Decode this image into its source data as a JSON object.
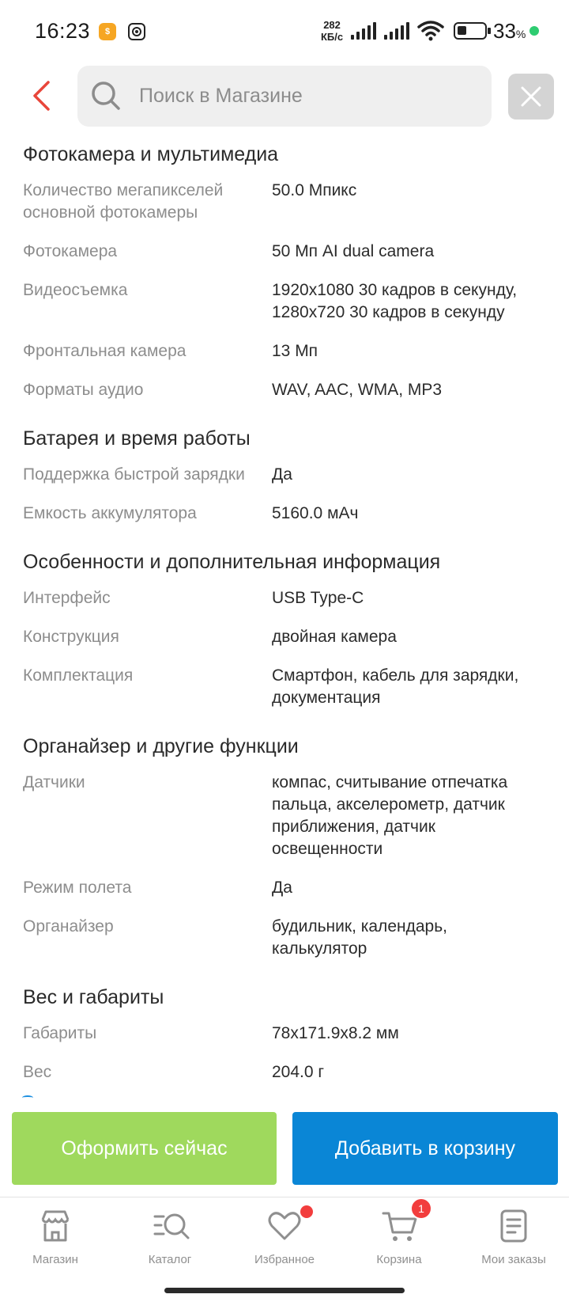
{
  "status_bar": {
    "time": "16:23",
    "net_speed_value": "282",
    "net_speed_unit": "КБ/с",
    "battery_percent": "33",
    "battery_percent_sign": "%",
    "battery_level": 0.33,
    "icons": [
      "notification-app-icon",
      "notification-game-icon",
      "signal-icon",
      "signal-icon",
      "wifi-icon",
      "battery-icon",
      "charging-dot-icon"
    ]
  },
  "header": {
    "search_placeholder": "Поиск в Магазине",
    "back_icon": "chevron-left-icon",
    "search_icon": "search-icon",
    "close_icon": "close-icon",
    "accent_color": "#e8463a"
  },
  "sections": [
    {
      "title": "Фотокамера и мультимедиа",
      "rows": [
        {
          "label": "Количество мегапикселей основной фотокамеры",
          "value": "50.0 Мпикс"
        },
        {
          "label": "Фотокамера",
          "value": "50 Мп AI dual camera"
        },
        {
          "label": "Видеосъемка",
          "value": "1920x1080 30 кадров в секунду, 1280x720 30 кадров в секунду"
        },
        {
          "label": "Фронтальная камера",
          "value": "13 Мп"
        },
        {
          "label": "Форматы аудио",
          "value": "WAV, AAC, WMA, MP3"
        }
      ]
    },
    {
      "title": "Батарея и время работы",
      "rows": [
        {
          "label": "Поддержка быстрой зарядки",
          "value": "Да"
        },
        {
          "label": "Емкость аккумулятора",
          "value": "5160.0 мАч"
        }
      ]
    },
    {
      "title": "Особенности и дополнительная информация",
      "rows": [
        {
          "label": "Интерфейс",
          "value": "USB Type-C"
        },
        {
          "label": "Конструкция",
          "value": "двойная камера"
        },
        {
          "label": "Комплектация",
          "value": "Смартфон, кабель для зарядки, документация"
        }
      ]
    },
    {
      "title": "Органайзер и другие функции",
      "rows": [
        {
          "label": "Датчики",
          "value": "компас, считывание отпечатка пальца, акселерометр, датчик приближения, датчик освещенности"
        },
        {
          "label": "Режим полета",
          "value": "Да"
        },
        {
          "label": "Органайзер",
          "value": "будильник, календарь, калькулятор"
        }
      ]
    },
    {
      "title": "Вес и габариты",
      "rows": [
        {
          "label": "Габариты",
          "value": "78x171.9x8.2 мм"
        },
        {
          "label": "Вес",
          "value": "204.0 г"
        }
      ]
    }
  ],
  "actions": {
    "buy_now_label": "Оформить сейчас",
    "buy_now_color": "#9fd95d",
    "add_to_cart_label": "Добавить в корзину",
    "add_to_cart_color": "#0a86d6"
  },
  "bottom_nav": [
    {
      "label": "Магазин",
      "icon": "store-icon"
    },
    {
      "label": "Каталог",
      "icon": "catalog-search-icon"
    },
    {
      "label": "Избранное",
      "icon": "heart-icon",
      "has_dot": true
    },
    {
      "label": "Корзина",
      "icon": "cart-icon",
      "badge": "1"
    },
    {
      "label": "Мои заказы",
      "icon": "orders-icon"
    }
  ]
}
